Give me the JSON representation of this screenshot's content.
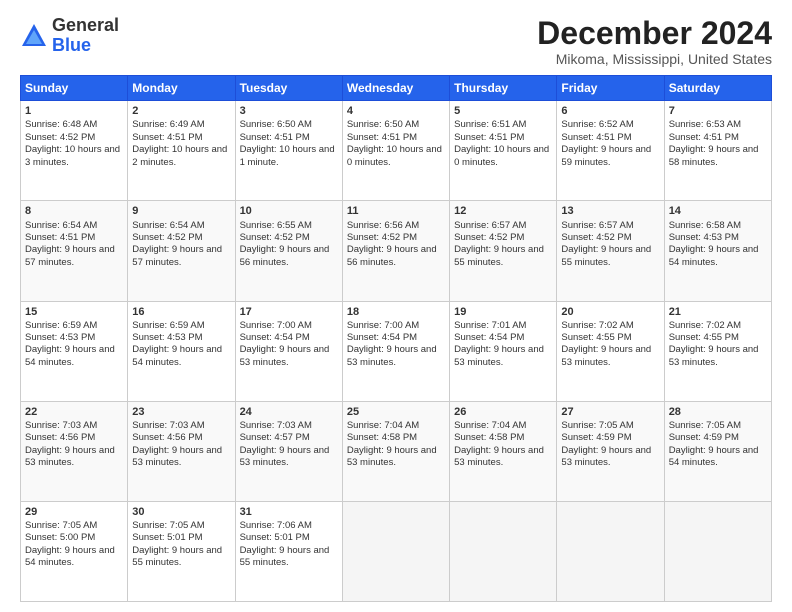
{
  "logo": {
    "general": "General",
    "blue": "Blue"
  },
  "title": "December 2024",
  "subtitle": "Mikoma, Mississippi, United States",
  "headers": [
    "Sunday",
    "Monday",
    "Tuesday",
    "Wednesday",
    "Thursday",
    "Friday",
    "Saturday"
  ],
  "weeks": [
    [
      {
        "day": "1",
        "sunrise": "Sunrise: 6:48 AM",
        "sunset": "Sunset: 4:52 PM",
        "daylight": "Daylight: 10 hours and 3 minutes."
      },
      {
        "day": "2",
        "sunrise": "Sunrise: 6:49 AM",
        "sunset": "Sunset: 4:51 PM",
        "daylight": "Daylight: 10 hours and 2 minutes."
      },
      {
        "day": "3",
        "sunrise": "Sunrise: 6:50 AM",
        "sunset": "Sunset: 4:51 PM",
        "daylight": "Daylight: 10 hours and 1 minute."
      },
      {
        "day": "4",
        "sunrise": "Sunrise: 6:50 AM",
        "sunset": "Sunset: 4:51 PM",
        "daylight": "Daylight: 10 hours and 0 minutes."
      },
      {
        "day": "5",
        "sunrise": "Sunrise: 6:51 AM",
        "sunset": "Sunset: 4:51 PM",
        "daylight": "Daylight: 10 hours and 0 minutes."
      },
      {
        "day": "6",
        "sunrise": "Sunrise: 6:52 AM",
        "sunset": "Sunset: 4:51 PM",
        "daylight": "Daylight: 9 hours and 59 minutes."
      },
      {
        "day": "7",
        "sunrise": "Sunrise: 6:53 AM",
        "sunset": "Sunset: 4:51 PM",
        "daylight": "Daylight: 9 hours and 58 minutes."
      }
    ],
    [
      {
        "day": "8",
        "sunrise": "Sunrise: 6:54 AM",
        "sunset": "Sunset: 4:51 PM",
        "daylight": "Daylight: 9 hours and 57 minutes."
      },
      {
        "day": "9",
        "sunrise": "Sunrise: 6:54 AM",
        "sunset": "Sunset: 4:52 PM",
        "daylight": "Daylight: 9 hours and 57 minutes."
      },
      {
        "day": "10",
        "sunrise": "Sunrise: 6:55 AM",
        "sunset": "Sunset: 4:52 PM",
        "daylight": "Daylight: 9 hours and 56 minutes."
      },
      {
        "day": "11",
        "sunrise": "Sunrise: 6:56 AM",
        "sunset": "Sunset: 4:52 PM",
        "daylight": "Daylight: 9 hours and 56 minutes."
      },
      {
        "day": "12",
        "sunrise": "Sunrise: 6:57 AM",
        "sunset": "Sunset: 4:52 PM",
        "daylight": "Daylight: 9 hours and 55 minutes."
      },
      {
        "day": "13",
        "sunrise": "Sunrise: 6:57 AM",
        "sunset": "Sunset: 4:52 PM",
        "daylight": "Daylight: 9 hours and 55 minutes."
      },
      {
        "day": "14",
        "sunrise": "Sunrise: 6:58 AM",
        "sunset": "Sunset: 4:53 PM",
        "daylight": "Daylight: 9 hours and 54 minutes."
      }
    ],
    [
      {
        "day": "15",
        "sunrise": "Sunrise: 6:59 AM",
        "sunset": "Sunset: 4:53 PM",
        "daylight": "Daylight: 9 hours and 54 minutes."
      },
      {
        "day": "16",
        "sunrise": "Sunrise: 6:59 AM",
        "sunset": "Sunset: 4:53 PM",
        "daylight": "Daylight: 9 hours and 54 minutes."
      },
      {
        "day": "17",
        "sunrise": "Sunrise: 7:00 AM",
        "sunset": "Sunset: 4:54 PM",
        "daylight": "Daylight: 9 hours and 53 minutes."
      },
      {
        "day": "18",
        "sunrise": "Sunrise: 7:00 AM",
        "sunset": "Sunset: 4:54 PM",
        "daylight": "Daylight: 9 hours and 53 minutes."
      },
      {
        "day": "19",
        "sunrise": "Sunrise: 7:01 AM",
        "sunset": "Sunset: 4:54 PM",
        "daylight": "Daylight: 9 hours and 53 minutes."
      },
      {
        "day": "20",
        "sunrise": "Sunrise: 7:02 AM",
        "sunset": "Sunset: 4:55 PM",
        "daylight": "Daylight: 9 hours and 53 minutes."
      },
      {
        "day": "21",
        "sunrise": "Sunrise: 7:02 AM",
        "sunset": "Sunset: 4:55 PM",
        "daylight": "Daylight: 9 hours and 53 minutes."
      }
    ],
    [
      {
        "day": "22",
        "sunrise": "Sunrise: 7:03 AM",
        "sunset": "Sunset: 4:56 PM",
        "daylight": "Daylight: 9 hours and 53 minutes."
      },
      {
        "day": "23",
        "sunrise": "Sunrise: 7:03 AM",
        "sunset": "Sunset: 4:56 PM",
        "daylight": "Daylight: 9 hours and 53 minutes."
      },
      {
        "day": "24",
        "sunrise": "Sunrise: 7:03 AM",
        "sunset": "Sunset: 4:57 PM",
        "daylight": "Daylight: 9 hours and 53 minutes."
      },
      {
        "day": "25",
        "sunrise": "Sunrise: 7:04 AM",
        "sunset": "Sunset: 4:58 PM",
        "daylight": "Daylight: 9 hours and 53 minutes."
      },
      {
        "day": "26",
        "sunrise": "Sunrise: 7:04 AM",
        "sunset": "Sunset: 4:58 PM",
        "daylight": "Daylight: 9 hours and 53 minutes."
      },
      {
        "day": "27",
        "sunrise": "Sunrise: 7:05 AM",
        "sunset": "Sunset: 4:59 PM",
        "daylight": "Daylight: 9 hours and 53 minutes."
      },
      {
        "day": "28",
        "sunrise": "Sunrise: 7:05 AM",
        "sunset": "Sunset: 4:59 PM",
        "daylight": "Daylight: 9 hours and 54 minutes."
      }
    ],
    [
      {
        "day": "29",
        "sunrise": "Sunrise: 7:05 AM",
        "sunset": "Sunset: 5:00 PM",
        "daylight": "Daylight: 9 hours and 54 minutes."
      },
      {
        "day": "30",
        "sunrise": "Sunrise: 7:05 AM",
        "sunset": "Sunset: 5:01 PM",
        "daylight": "Daylight: 9 hours and 55 minutes."
      },
      {
        "day": "31",
        "sunrise": "Sunrise: 7:06 AM",
        "sunset": "Sunset: 5:01 PM",
        "daylight": "Daylight: 9 hours and 55 minutes."
      },
      null,
      null,
      null,
      null
    ]
  ]
}
